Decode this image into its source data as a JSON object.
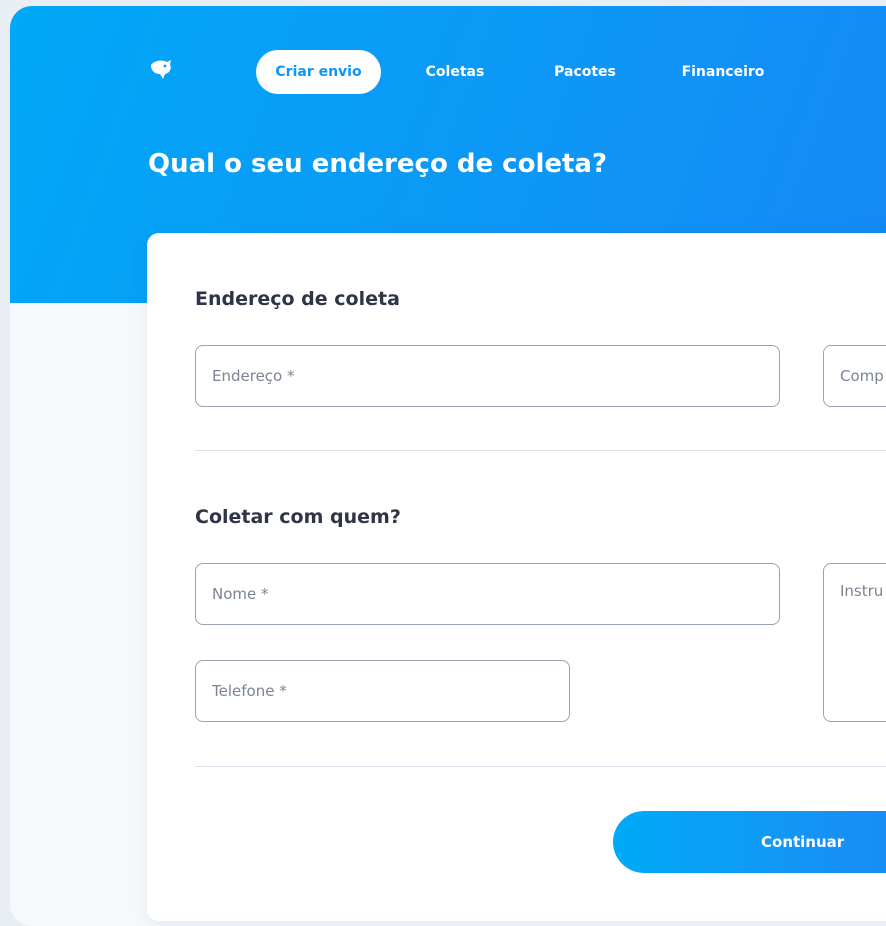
{
  "nav": {
    "items": [
      {
        "label": "Criar envio",
        "active": true
      },
      {
        "label": "Coletas",
        "active": false
      },
      {
        "label": "Pacotes",
        "active": false
      },
      {
        "label": "Financeiro",
        "active": false
      }
    ]
  },
  "header": {
    "title": "Qual o seu endereço de coleta?"
  },
  "address_section": {
    "title": "Endereço de coleta",
    "address_placeholder": "Endereço *",
    "complement_placeholder": "Comp"
  },
  "contact_section": {
    "title": "Coletar com quem?",
    "name_placeholder": "Nome *",
    "phone_placeholder": "Telefone *",
    "instructions_placeholder": "Instru"
  },
  "actions": {
    "continue_label": "Continuar"
  },
  "colors": {
    "brand_blue": "#0e96f6",
    "background": "#f6f9fc",
    "title_text": "#2d3546",
    "field_border": "#98a3b3"
  }
}
